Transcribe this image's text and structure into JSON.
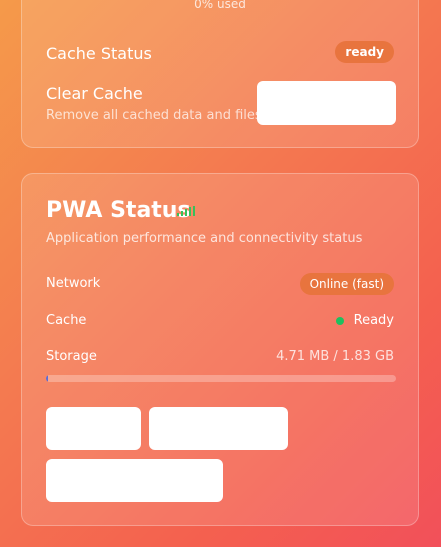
{
  "storage_summary": {
    "used_text": "0% used"
  },
  "cache_section": {
    "status_label": "Cache Status",
    "status_value": "ready",
    "clear_title": "Clear Cache",
    "clear_description": "Remove all cached data and files",
    "clear_button_label": ""
  },
  "pwa_status": {
    "title": "PWA Status",
    "subtitle": "Application performance and connectivity status",
    "network_label": "Network",
    "network_value": "Online (fast)",
    "cache_label": "Cache",
    "cache_value": "Ready",
    "storage_label": "Storage",
    "storage_value": "4.71 MB / 1.83 GB",
    "storage_used_fraction": 0.0025,
    "buttons": [
      "",
      "",
      ""
    ]
  },
  "colors": {
    "badge": "#e8743e",
    "online_dot": "#1fbf5f",
    "signal": "#39c05a",
    "progress_fill": "#5b6bd6"
  },
  "icons": {
    "signal": "signal-strength-icon",
    "status_dot": "status-dot-icon"
  }
}
